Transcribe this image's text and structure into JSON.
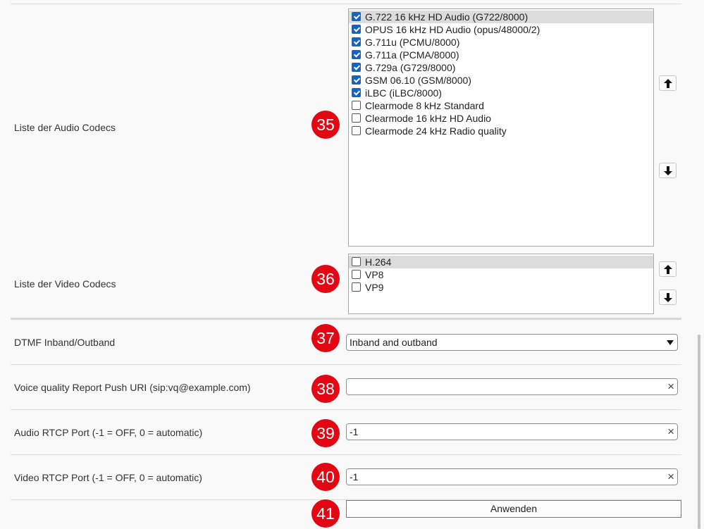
{
  "audio": {
    "label": "Liste der Audio Codecs",
    "badge": "35",
    "codecs": [
      {
        "label": "G.722 16 kHz HD Audio (G722/8000)",
        "checked": true,
        "selected": true
      },
      {
        "label": "OPUS 16 kHz HD Audio (opus/48000/2)",
        "checked": true,
        "selected": false
      },
      {
        "label": "G.711u (PCMU/8000)",
        "checked": true,
        "selected": false
      },
      {
        "label": "G.711a (PCMA/8000)",
        "checked": true,
        "selected": false
      },
      {
        "label": "G.729a (G729/8000)",
        "checked": true,
        "selected": false
      },
      {
        "label": "GSM 06.10 (GSM/8000)",
        "checked": true,
        "selected": false
      },
      {
        "label": "iLBC (iLBC/8000)",
        "checked": true,
        "selected": false
      },
      {
        "label": "Clearmode 8 kHz Standard",
        "checked": false,
        "selected": false
      },
      {
        "label": "Clearmode 16 kHz HD Audio",
        "checked": false,
        "selected": false
      },
      {
        "label": "Clearmode 24 kHz Radio quality",
        "checked": false,
        "selected": false
      }
    ]
  },
  "video": {
    "label": "Liste der Video Codecs",
    "badge": "36",
    "codecs": [
      {
        "label": "H.264",
        "checked": false,
        "selected": true
      },
      {
        "label": "VP8",
        "checked": false,
        "selected": false
      },
      {
        "label": "VP9",
        "checked": false,
        "selected": false
      }
    ]
  },
  "dtmf": {
    "label": "DTMF Inband/Outband",
    "badge": "37",
    "value": "Inband and outband"
  },
  "vq_uri": {
    "label": "Voice quality Report Push URI (sip:vq@example.com)",
    "badge": "38",
    "value": ""
  },
  "audio_rtcp": {
    "label": "Audio RTCP Port (-1 = OFF, 0 = automatic)",
    "badge": "39",
    "value": "-1"
  },
  "video_rtcp": {
    "label": "Video RTCP Port (-1 = OFF, 0 = automatic)",
    "badge": "40",
    "value": "-1"
  },
  "apply": {
    "label": "Anwenden",
    "badge": "41"
  },
  "icons": {
    "clear": "×",
    "up": "arrow-up-icon",
    "down": "arrow-down-icon"
  },
  "colors": {
    "badge": "#e30613",
    "checkbox": "#1565c0"
  }
}
